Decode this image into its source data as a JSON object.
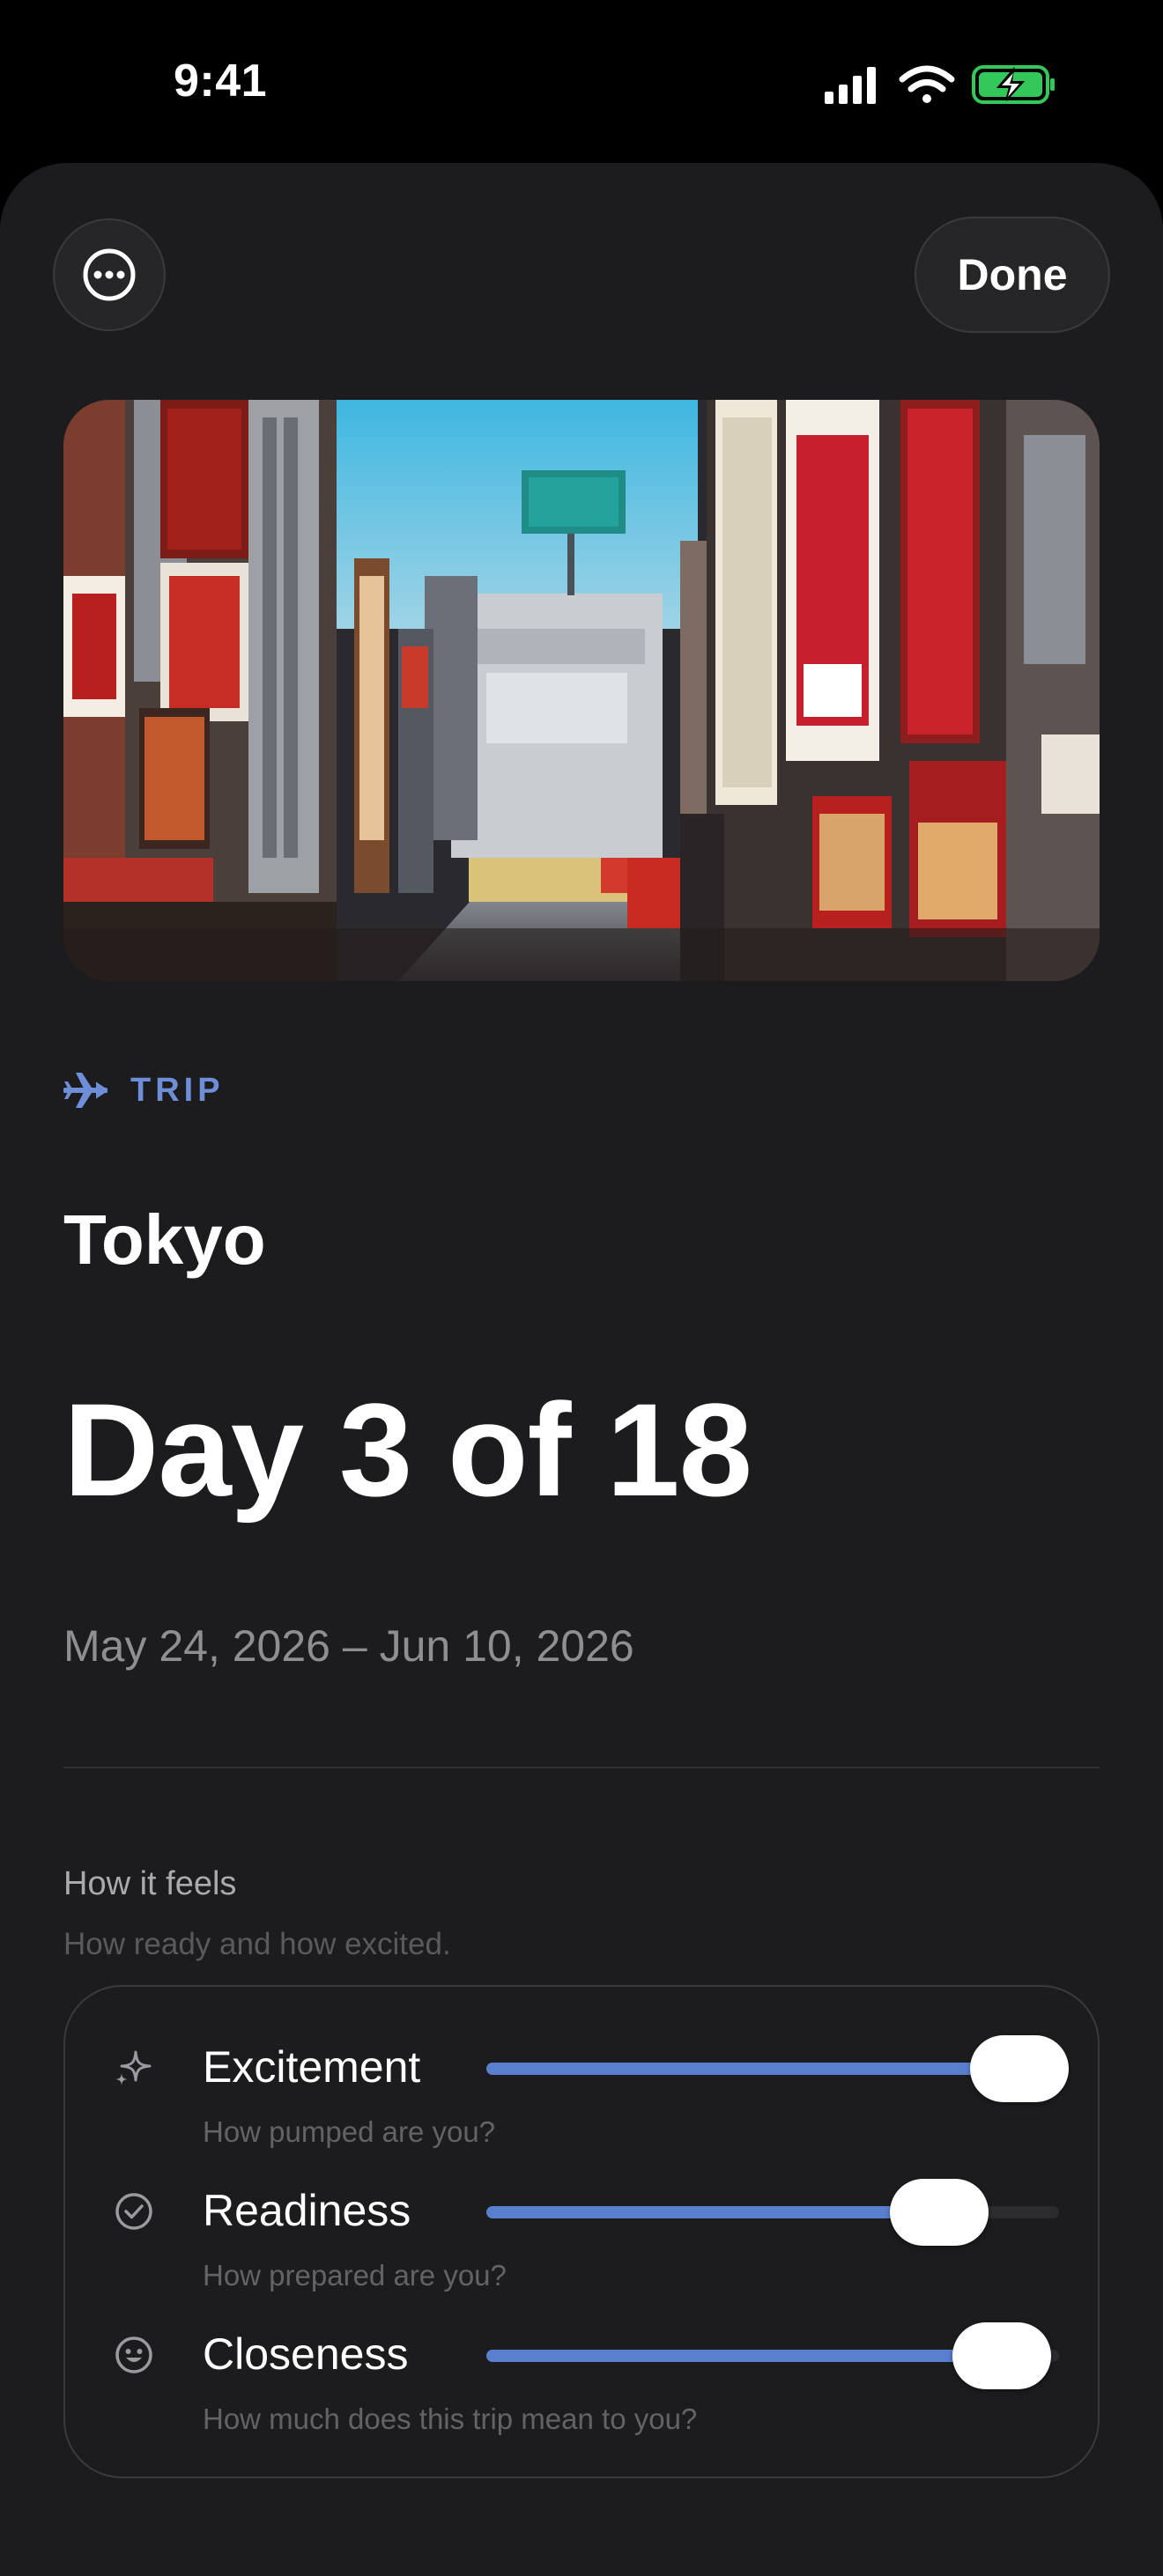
{
  "status_bar": {
    "time": "9:41",
    "icons": [
      "signal-icon",
      "wifi-icon",
      "battery-charging-icon"
    ],
    "battery_color": "#34c759"
  },
  "toolbar": {
    "more_icon": "ellipsis-circle-icon",
    "done_label": "Done"
  },
  "hero": {
    "subject": "Tokyo street with neon signs"
  },
  "trip": {
    "tag_icon": "airplane-icon",
    "tag_label": "TRIP",
    "accent_color": "#6f8ed8",
    "city": "Tokyo",
    "day_text": "Day 3 of 18",
    "date_range": "May 24, 2026 – Jun 10, 2026"
  },
  "feels": {
    "title": "How it feels",
    "subtitle": "How ready and how excited.",
    "sliders": [
      {
        "icon": "sparkle-icon",
        "label": "Excitement",
        "hint": "How pumped are you?",
        "value": 0.93
      },
      {
        "icon": "checkmark-circle-icon",
        "label": "Readiness",
        "hint": "How prepared are you?",
        "value": 0.79
      },
      {
        "icon": "smiley-face-icon",
        "label": "Closeness",
        "hint": "How much does this trip mean to you?",
        "value": 0.9
      }
    ]
  }
}
